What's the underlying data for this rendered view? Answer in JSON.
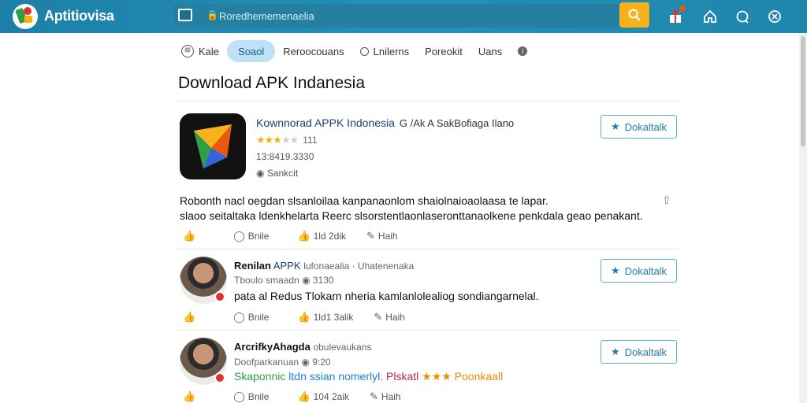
{
  "header": {
    "brand": "Aptitiovisa",
    "search_placeholder": "Roredhememenaelia",
    "icons": [
      "logo-icon",
      "box-icon",
      "lock-icon",
      "search-icon",
      "gift-icon",
      "home-icon",
      "chat-icon",
      "user-icon"
    ]
  },
  "nav": {
    "tabs": [
      {
        "label": "Kale",
        "icon": "feather-icon"
      },
      {
        "label": "Soaol",
        "active": true
      },
      {
        "label": "Reroocouans"
      },
      {
        "label": "Lnilerns",
        "icon": "clock-icon"
      },
      {
        "label": "Poreokit"
      },
      {
        "label": "Uans"
      }
    ]
  },
  "page": {
    "title": "Download APK Indanesia"
  },
  "app": {
    "name": "Kownnorad APPK Indonesia",
    "name_suffix": "G /Ak A SakBofiaga Ilano",
    "rating_stars": 3,
    "rating_count": "111",
    "meta": "13:8419.3330",
    "publisher": "Sankcit",
    "download_label": "Dokaltalk",
    "description_line1": "Robonth nacl oegdan slsanloilaa kanpanaonlom shaiolnaioaolaasa te lapar.",
    "description_line2": "slaoo seitaltaka ldenkhelarta Reerc slsorstentlaonlaseronttanaolkene penkdala geao penakant."
  },
  "post_actions": {
    "like": "",
    "share": "Bnile",
    "count": "1ld 2dik",
    "reply": "Haih"
  },
  "comments": [
    {
      "author": "Renilan",
      "app": "APPK",
      "context": "lufonaealia · Uhatenenaka",
      "meta_name": "Tboulo smaadn",
      "meta_value": "3130",
      "text": "pata al Redus Tlokarn nheria kamlanlolealiog sondiangarnelal.",
      "download_label": "Dokaltalk",
      "actions": {
        "share": "Bnile",
        "count": "1ld1 3alik",
        "reply": "Haih"
      }
    },
    {
      "author": "ArcrifkyAhagda",
      "context": "obulevaukans",
      "meta_name": "Doofparkanuan",
      "meta_value": "9:20",
      "text_green": "Skaponnic",
      "text_blue": "ltdn ssian nomerlyl.",
      "text_red": "Plskatl",
      "text_stars": "★★★",
      "text_gold": "Poonkaall",
      "download_label": "Dokaltalk",
      "actions": {
        "share": "Bnile",
        "count": "104 2aik",
        "reply": "Haih"
      }
    }
  ],
  "colors": {
    "header": "#2491b6",
    "accent_search": "#f7b21b",
    "active_tab": "#bfe1f5",
    "link": "#2379ab"
  }
}
